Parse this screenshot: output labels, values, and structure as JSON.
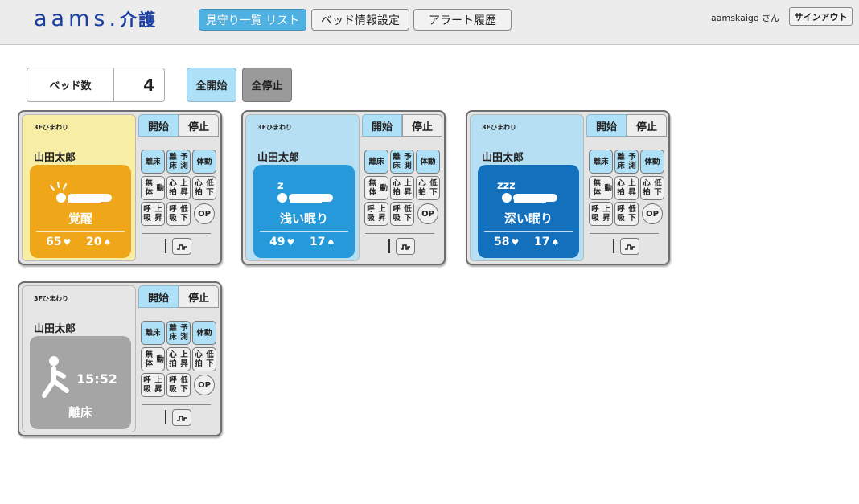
{
  "header": {
    "logo_latin": "aams.",
    "logo_kanji": "介護",
    "tabs": [
      {
        "label": "見守り一覧 リスト",
        "active": true
      },
      {
        "label": "ベッド情報設定",
        "active": false
      },
      {
        "label": "アラート履歴",
        "active": false
      }
    ],
    "user_label": "aamskaigo さん",
    "signout_label": "サインアウト"
  },
  "controls": {
    "bed_count_label": "ベッド数",
    "bed_count_value": "4",
    "start_all_label": "全開始",
    "stop_all_label": "全停止"
  },
  "cards": [
    {
      "location": "3Fひまわり",
      "name": "山田太郎",
      "state": "awake",
      "status_label": "覚醒",
      "heart_rate": "65",
      "resp_rate": "20",
      "start_label": "開始",
      "stop_label": "停止",
      "alerts": [
        {
          "label": "離床",
          "on": true
        },
        {
          "label": "離床予測",
          "on": true
        },
        {
          "label": "体動",
          "on": true
        },
        {
          "label": "無体動",
          "on": false
        },
        {
          "label": "心拍上昇",
          "on": false
        },
        {
          "label": "心拍低下",
          "on": false
        },
        {
          "label": "呼吸上昇",
          "on": false
        },
        {
          "label": "呼吸低下",
          "on": false
        }
      ],
      "op_label": "OP"
    },
    {
      "location": "3Fひまわり",
      "name": "山田太郎",
      "state": "light",
      "status_label": "浅い眠り",
      "heart_rate": "49",
      "resp_rate": "17",
      "start_label": "開始",
      "stop_label": "停止",
      "alerts": [
        {
          "label": "離床",
          "on": true
        },
        {
          "label": "離床予測",
          "on": true
        },
        {
          "label": "体動",
          "on": true
        },
        {
          "label": "無体動",
          "on": false
        },
        {
          "label": "心拍上昇",
          "on": false
        },
        {
          "label": "心拍低下",
          "on": false
        },
        {
          "label": "呼吸上昇",
          "on": false
        },
        {
          "label": "呼吸低下",
          "on": false
        }
      ],
      "op_label": "OP"
    },
    {
      "location": "3Fひまわり",
      "name": "山田太郎",
      "state": "deep",
      "status_label": "深い眠り",
      "heart_rate": "58",
      "resp_rate": "17",
      "start_label": "開始",
      "stop_label": "停止",
      "alerts": [
        {
          "label": "離床",
          "on": true
        },
        {
          "label": "離床予測",
          "on": true
        },
        {
          "label": "体動",
          "on": true
        },
        {
          "label": "無体動",
          "on": false
        },
        {
          "label": "心拍上昇",
          "on": false
        },
        {
          "label": "心拍低下",
          "on": false
        },
        {
          "label": "呼吸上昇",
          "on": false
        },
        {
          "label": "呼吸低下",
          "on": false
        }
      ],
      "op_label": "OP"
    },
    {
      "location": "3Fひまわり",
      "name": "山田太郎",
      "state": "out",
      "status_label": "離床",
      "time": "15:52",
      "start_label": "開始",
      "stop_label": "停止",
      "alerts": [
        {
          "label": "離床",
          "on": true
        },
        {
          "label": "離床予測",
          "on": true
        },
        {
          "label": "体動",
          "on": true
        },
        {
          "label": "無体動",
          "on": false
        },
        {
          "label": "心拍上昇",
          "on": false
        },
        {
          "label": "心拍低下",
          "on": false
        },
        {
          "label": "呼吸上昇",
          "on": false
        },
        {
          "label": "呼吸低下",
          "on": false
        }
      ],
      "op_label": "OP"
    }
  ],
  "icons": {
    "heart": "heart-icon",
    "lungs": "lungs-icon",
    "wave": "waveform-icon"
  },
  "colors": {
    "awake": "#efa719",
    "light": "#2599d9",
    "deep": "#1270bd",
    "out": "#a5a5a5",
    "accent": "#4fb1e2"
  }
}
